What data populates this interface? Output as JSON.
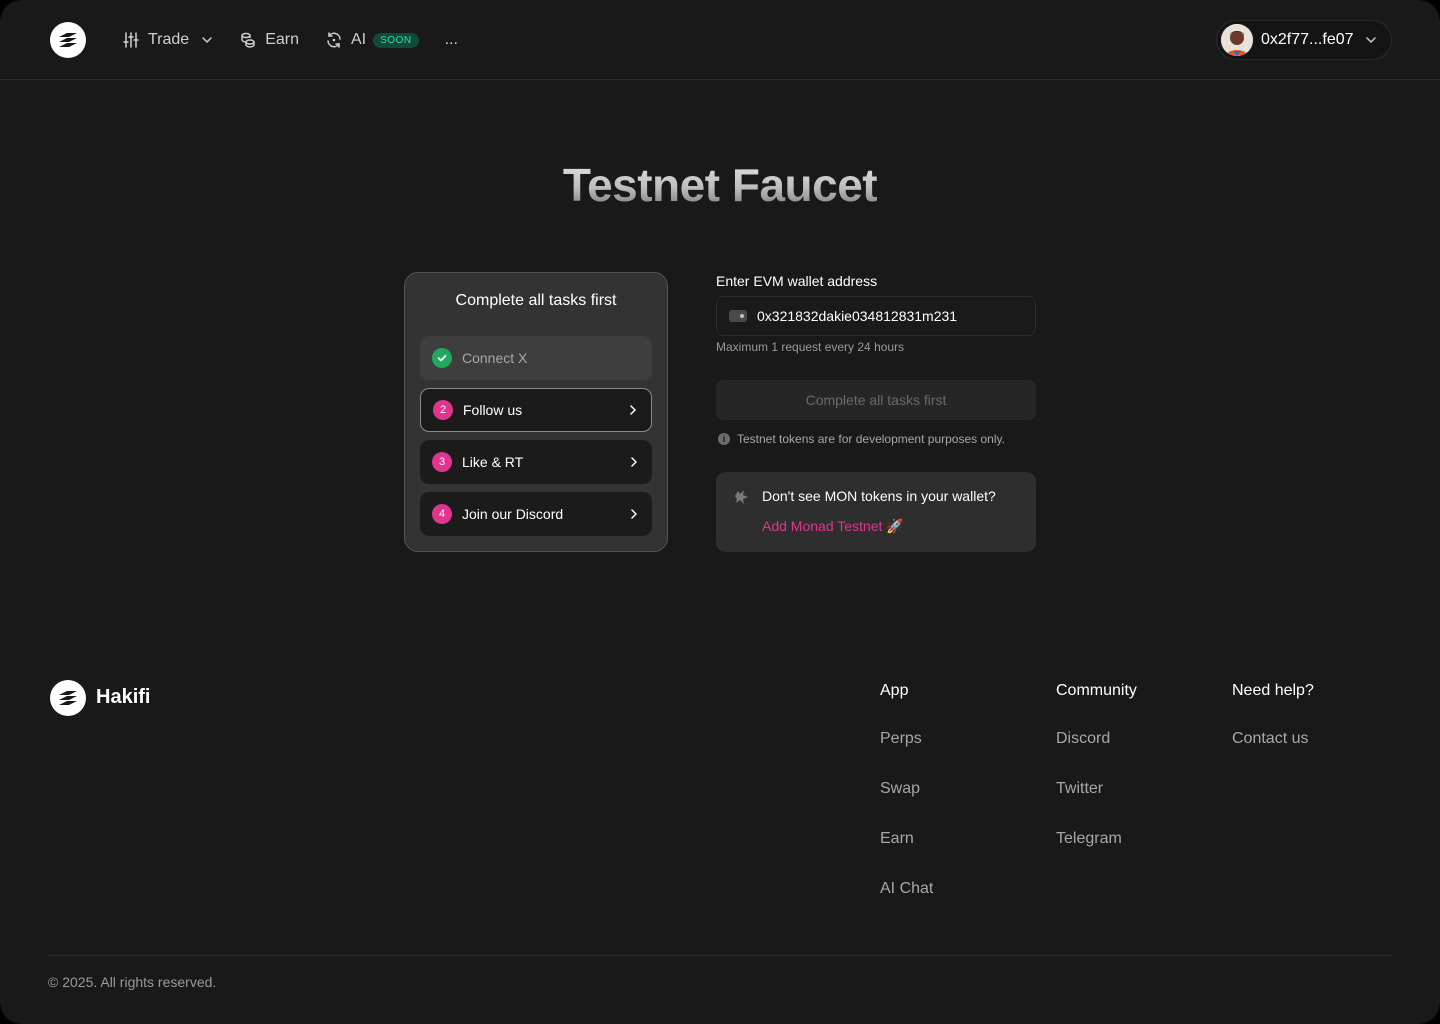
{
  "header": {
    "nav": [
      {
        "label": "Trade",
        "icon": "sliders-icon"
      },
      {
        "label": "Earn",
        "icon": "coins-icon"
      },
      {
        "label": "AI",
        "icon": "ai-refresh-icon",
        "badge": "SOON"
      }
    ],
    "more_label": "...",
    "wallet": {
      "address": "0x2f77...fe07"
    }
  },
  "page_title": "Testnet Faucet",
  "tasks": {
    "title": "Complete all tasks first",
    "items": [
      {
        "label": "Connect X",
        "status": "done"
      },
      {
        "number": "2",
        "label": "Follow us",
        "status": "active"
      },
      {
        "number": "3",
        "label": "Like & RT",
        "status": "pending"
      },
      {
        "number": "4",
        "label": "Join our Discord",
        "status": "pending"
      }
    ]
  },
  "form": {
    "label": "Enter EVM wallet address",
    "address_value": "0x321832dakie034812831m231",
    "hint": "Maximum 1 request every 24 hours",
    "submit_label": "Complete all tasks first",
    "note": "Testnet tokens are for development purposes only."
  },
  "mon_card": {
    "text": "Don't see MON tokens in your wallet?",
    "link": "Add Monad Testnet 🚀"
  },
  "footer": {
    "brand": "Hakifi",
    "columns": [
      {
        "heading": "App",
        "links": [
          "Perps",
          "Swap",
          "Earn",
          "AI Chat"
        ]
      },
      {
        "heading": "Community",
        "links": [
          "Discord",
          "Twitter",
          "Telegram"
        ]
      },
      {
        "heading": "Need help?",
        "links": [
          "Contact us"
        ]
      }
    ],
    "copyright": "© 2025. All rights reserved."
  },
  "colors": {
    "background": "#191919",
    "accent_pink": "#e0358f",
    "success_green": "#1eaa5a",
    "soon_badge_text": "#3ddca0"
  }
}
